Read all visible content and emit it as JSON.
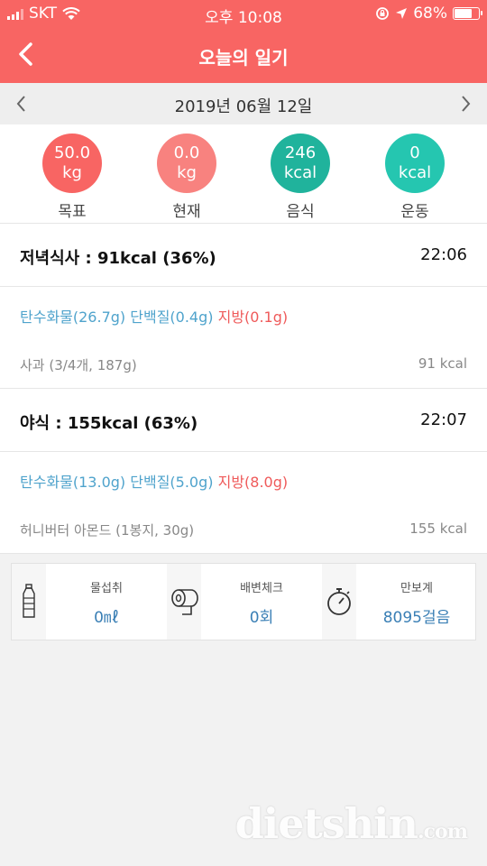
{
  "status_bar": {
    "carrier": "SKT",
    "time": "오후 10:08",
    "battery": "68%",
    "battery_level": 0.68
  },
  "nav": {
    "title": "오늘의 일기"
  },
  "date_bar": {
    "date": "2019년 06월 12일"
  },
  "summary": [
    {
      "value": "50.0",
      "unit": "kg",
      "label": "목표",
      "color": "#f86563"
    },
    {
      "value": "0.0",
      "unit": "kg",
      "label": "현재",
      "color": "#f8827f"
    },
    {
      "value": "246",
      "unit": "kcal",
      "label": "음식",
      "color": "#20b39c"
    },
    {
      "value": "0",
      "unit": "kcal",
      "label": "운동",
      "color": "#25c6b0"
    }
  ],
  "meals": [
    {
      "title": "저녁식사 : 91kcal (36%)",
      "time": "22:06",
      "carb": "탄수화물(26.7g)",
      "protein": "단백질(0.4g)",
      "fat": "지방(0.1g)",
      "food": "사과 (3/4개, 187g)",
      "food_kcal": "91 kcal"
    },
    {
      "title": "야식 : 155kcal (63%)",
      "time": "22:07",
      "carb": "탄수화물(13.0g)",
      "protein": "단백질(5.0g)",
      "fat": "지방(8.0g)",
      "food": "허니버터 아몬드 (1봉지, 30g)",
      "food_kcal": "155 kcal"
    }
  ],
  "trackers": [
    {
      "icon": "water-bottle-icon",
      "label": "물섭취",
      "value": "0㎖"
    },
    {
      "icon": "toilet-paper-icon",
      "label": "배변체크",
      "value": "0회"
    },
    {
      "icon": "stopwatch-icon",
      "label": "만보계",
      "value": "8095걸음"
    }
  ],
  "watermark": {
    "text": "dietshin",
    "suffix": ".com"
  }
}
